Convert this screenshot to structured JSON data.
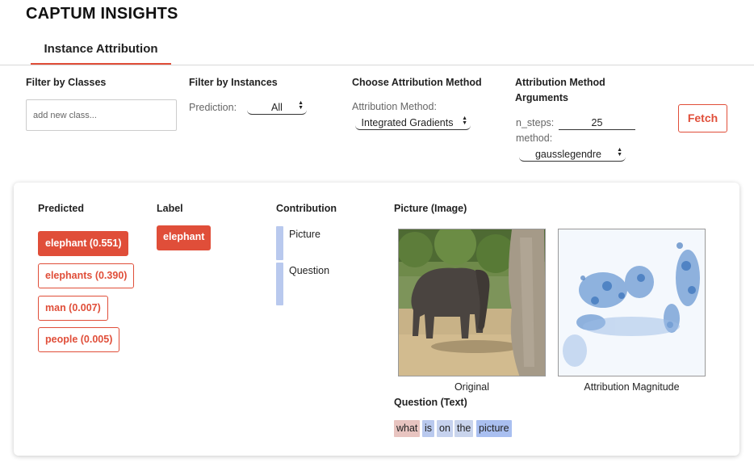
{
  "app": {
    "title": "CAPTUM INSIGHTS"
  },
  "tabs": [
    {
      "label": "Instance Attribution",
      "active": true
    }
  ],
  "filters": {
    "classes": {
      "heading": "Filter by Classes",
      "placeholder": "add new class..."
    },
    "instances": {
      "heading": "Filter by Instances",
      "prediction_label": "Prediction:",
      "prediction_value": "All"
    },
    "method": {
      "heading": "Choose Attribution Method",
      "label": "Attribution Method:",
      "value": "Integrated Gradients"
    },
    "arguments": {
      "heading_line1": "Attribution Method",
      "heading_line2": "Arguments",
      "n_steps_label": "n_steps:",
      "n_steps_value": "25",
      "method_label": "method:",
      "method_value": "gausslegendre"
    },
    "fetch_label": "Fetch"
  },
  "instance": {
    "headings": {
      "predicted": "Predicted",
      "label": "Label",
      "contribution": "Contribution",
      "picture": "Picture (Image)",
      "question": "Question (Text)"
    },
    "predictions": [
      {
        "text": "elephant (0.551)",
        "selected": true
      },
      {
        "text": "elephants (0.390)",
        "selected": false
      },
      {
        "text": "man (0.007)",
        "selected": false
      },
      {
        "text": "people (0.005)",
        "selected": false
      }
    ],
    "label": "elephant",
    "contributions": [
      {
        "name": "Picture",
        "fraction": 0.5
      },
      {
        "name": "Question",
        "fraction": 0.5
      }
    ],
    "images": {
      "original_caption": "Original",
      "attribution_caption": "Attribution Magnitude"
    },
    "question_tokens": [
      {
        "text": "what",
        "color": "#e8c4c0"
      },
      {
        "text": "is",
        "color": "#b9c9ee"
      },
      {
        "text": "on",
        "color": "#c6d2ee"
      },
      {
        "text": "the",
        "color": "#c9d4ec"
      },
      {
        "text": "picture",
        "color": "#a9bff0"
      }
    ]
  },
  "colors": {
    "accent": "#e04e39",
    "contribution_bar": "#b9c9ee"
  }
}
